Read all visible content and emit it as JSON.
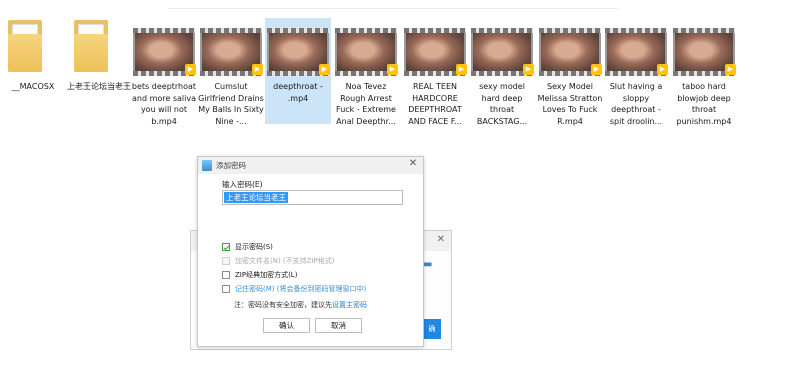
{
  "explorer": {
    "files": [
      {
        "name": "__MACOSX",
        "type": "folder"
      },
      {
        "name": "上老王论坛当老王",
        "type": "folder"
      },
      {
        "name": "bets deeptrhoat and more saliva you will not b.mp4",
        "type": "video",
        "badge_icon": "player-badge-icon"
      },
      {
        "name": "Cumslut Girlfriend Drains My Balls In Sixty Nine -...",
        "type": "video",
        "badge_icon": "player-badge-icon"
      },
      {
        "name": "deepthroat - .mp4",
        "type": "video",
        "selected": true,
        "badge_icon": "player-badge-icon"
      },
      {
        "name": "Noa Tevez Rough Arrest Fuck - Extreme Anal Deepthr...",
        "type": "video",
        "badge_icon": "player-badge-icon"
      },
      {
        "name": "REAL TEEN HARDCORE DEEPTHROAT AND FACE F...",
        "type": "video",
        "badge_icon": "player-badge-icon"
      },
      {
        "name": "sexy model hard deep throat BACKSTAG...",
        "type": "video",
        "badge_icon": "player-badge-icon"
      },
      {
        "name": "Sexy Model Melissa Stratton Loves To Fuck R.mp4",
        "type": "video",
        "badge_icon": "player-badge-icon"
      },
      {
        "name": "Slut having a sloppy deepthroat - spit droolin...",
        "type": "video",
        "badge_icon": "player-badge-icon"
      },
      {
        "name": "taboo hard blowjob deep throat punishm.mp4",
        "type": "video",
        "badge_icon": "player-badge-icon"
      }
    ]
  },
  "back_dialog": {
    "close_glyph": "✕",
    "button_label": "确"
  },
  "password_dialog": {
    "title": "添加密码",
    "close_glyph": "✕",
    "password_label": "输入密码(E)",
    "password_value": "上老王论坛当老王",
    "options": [
      {
        "label": "显示密码(S)",
        "checked": true,
        "enabled": true
      },
      {
        "label": "加密文件名(N) (不支持ZIP格式)",
        "checked": false,
        "enabled": false
      },
      {
        "label": "ZIP经典加密方式(L)",
        "checked": false,
        "enabled": true
      },
      {
        "label": "记住密码(M) (将会备份到密码管理窗口中)",
        "checked": false,
        "enabled": true
      }
    ],
    "note_text": "注：密码没有安全加密，建议先",
    "note_link": "设置主密码",
    "ok_label": "确认",
    "cancel_label": "取消"
  }
}
